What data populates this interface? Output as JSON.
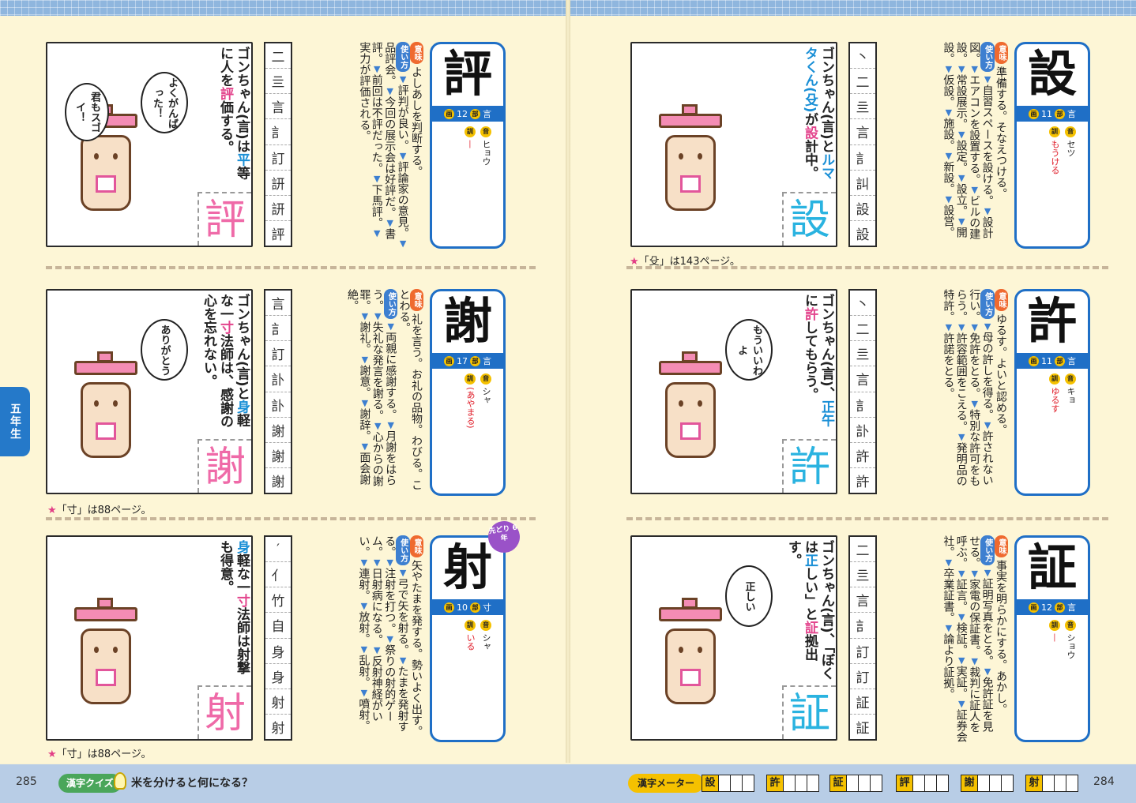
{
  "colors": {
    "accent": "#1f6fc6",
    "pink": "#e3458d",
    "meaning": "#ef6a2f",
    "usage": "#3d7fd0",
    "grade_tab": "#2579c9"
  },
  "labels": {
    "meaning": "意味",
    "usage": "使い方",
    "strokes": "画",
    "radical": "部",
    "on": "音",
    "kun": "訓"
  },
  "side_tab": "五年生",
  "left_page": {
    "entries": [
      {
        "kanji": "評",
        "strokes": "12",
        "radical": "言",
        "on": "ヒョウ",
        "kun": "—",
        "meaning": "よしあしを判断する。",
        "usage": [
          "評判が良い。",
          "評論家の意見。",
          "品評会。",
          "今回の展示会は好評だ。",
          "書評。",
          "前回は不評だった。",
          "下馬評。",
          "実力が評価される。"
        ],
        "note": {
          "pre": "ゴンちゃん(言)は",
          "hl1": "平",
          "mid": "等に人を",
          "hl2": "評",
          "post": "価する。"
        },
        "bubbles": [
          "よくがんばった！",
          "君もスゴイ！"
        ],
        "stroke_seq": [
          "二",
          "亖",
          "言",
          "訁",
          "訂",
          "訮",
          "訮",
          "評"
        ]
      },
      {
        "kanji": "謝",
        "strokes": "17",
        "radical": "言",
        "on": "シャ",
        "kun": "(あやまる)",
        "meaning": "礼を言う。お礼の品物。わびる。ことわる。",
        "usage": [
          "両親に感謝する。",
          "月謝をはらう。",
          "失礼な発言を謝る。",
          "心からの謝罪。",
          "謝礼。",
          "謝意。",
          "謝辞。",
          "面会謝絶。"
        ],
        "note": {
          "pre": "ゴンちゃん(言)と",
          "hl1": "身",
          "mid": "軽な一",
          "hl2": "寸",
          "post": "法師は、感謝の心を忘れない。"
        },
        "bubbles": [
          "ありがとう"
        ],
        "stroke_seq": [
          "言",
          "訁",
          "訂",
          "訃",
          "訃",
          "謝",
          "謝",
          "謝"
        ]
      },
      {
        "kanji": "射",
        "strokes": "10",
        "radical": "寸",
        "on": "シャ",
        "kun": "いる",
        "meaning": "矢やたまを発する。勢いよく出す。",
        "usage": [
          "弓で矢を射る。",
          "たまを発射する。",
          "注射を打つ。",
          "祭りの射的ゲーム。",
          "日射病になる。",
          "反射神経がいい。",
          "連射。",
          "放射。",
          "乱射。",
          "噴射。"
        ],
        "note": {
          "pre": "",
          "hl1": "身",
          "mid": "軽な一",
          "hl2": "寸",
          "post": "法師は射撃も得意。"
        },
        "bubbles": [],
        "badge": "先どり 6年",
        "stroke_seq": [
          "′",
          "亻",
          "竹",
          "自",
          "身",
          "身",
          "射",
          "射"
        ]
      }
    ],
    "footnotes": [
      "「寸」は88ページ。",
      "「寸」は88ページ。"
    ],
    "page_number": "285",
    "quiz_label": "漢字クイズ",
    "quiz_text": "米を分けると何になる？"
  },
  "right_page": {
    "entries": [
      {
        "kanji": "設",
        "strokes": "11",
        "radical": "言",
        "on": "セツ",
        "kun": "もうける",
        "meaning": "準備する。そなえつける。",
        "usage": [
          "自習スペースを設ける。",
          "設計図。",
          "エアコンを設置する。",
          "ビルの建設。",
          "常設展示。",
          "設定。",
          "設立。",
          "開設。",
          "仮設。",
          "施設。",
          "新設。",
          "設営。"
        ],
        "note": {
          "pre": "ゴンちゃん(言)と",
          "hl1": "ルマタくん(殳)",
          "mid": "が",
          "hl2": "設",
          "post": "計中。"
        },
        "bubbles": [],
        "stroke_seq": [
          "丶",
          "二",
          "亖",
          "言",
          "訁",
          "訆",
          "設",
          "設"
        ]
      },
      {
        "kanji": "許",
        "strokes": "11",
        "radical": "言",
        "on": "キョ",
        "kun": "ゆるす",
        "meaning": "ゆるす。よいと認める。",
        "usage": [
          "母の許しを得る。",
          "許されない行い。",
          "免許をとる。",
          "特別な許可をもらう。",
          "許容範囲をこえる。",
          "発明品の特許。",
          "許諾をとる。"
        ],
        "note": {
          "pre": "ゴンちゃん(言)、",
          "hl1": "正午",
          "mid": "に",
          "hl2": "許",
          "post": "してもらう。"
        },
        "bubbles": [
          "もういいわよ"
        ],
        "stroke_seq": [
          "丶",
          "二",
          "亖",
          "言",
          "訁",
          "訃",
          "許",
          "許"
        ]
      },
      {
        "kanji": "証",
        "strokes": "12",
        "radical": "言",
        "on": "ショウ",
        "kun": "—",
        "meaning": "事実を明らかにする。あかし。",
        "usage": [
          "証明写真をとる。",
          "免許証を見せる。",
          "家電の保証書。",
          "裁判に証人を呼ぶ。",
          "証言。",
          "検証。",
          "実証。",
          "証券会社。",
          "卒業証書。",
          "論より証拠。"
        ],
        "note": {
          "pre": "ゴンちゃん(言)、「ぼくは",
          "hl1": "正",
          "mid": "しい」と",
          "hl2": "証",
          "post": "拠出す。"
        },
        "bubbles": [
          "正しい"
        ],
        "stroke_seq": [
          "二",
          "亖",
          "言",
          "訁",
          "訂",
          "訂",
          "証",
          "証"
        ]
      }
    ],
    "footnotes": [
      "「殳」は143ページ。"
    ],
    "page_number": "284",
    "meter_label": "漢字メーター",
    "meter_kanji": [
      "設",
      "許",
      "証",
      "評",
      "謝",
      "射"
    ]
  }
}
